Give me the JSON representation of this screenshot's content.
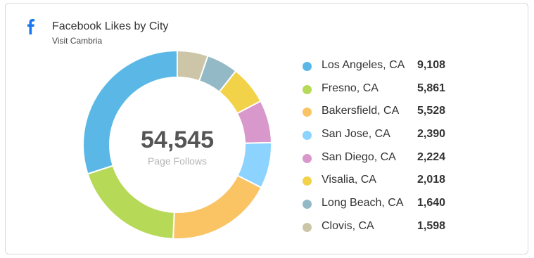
{
  "header": {
    "icon": "facebook-icon",
    "icon_color": "#1877f2",
    "title": "Facebook Likes by City",
    "subtitle": "Visit Cambria"
  },
  "center": {
    "total": "54,545",
    "label": "Page Follows"
  },
  "chart_data": {
    "type": "pie",
    "variant": "donut",
    "title": "Facebook Likes by City",
    "subtitle": "Visit Cambria",
    "legend_position": "right",
    "series": [
      {
        "name": "Los Angeles, CA",
        "value": 9108,
        "label": "9,108",
        "color": "#5bb8e6"
      },
      {
        "name": "Fresno, CA",
        "value": 5861,
        "label": "5,861",
        "color": "#b6d957"
      },
      {
        "name": "Bakersfield, CA",
        "value": 5528,
        "label": "5,528",
        "color": "#fac364"
      },
      {
        "name": "San Jose, CA",
        "value": 2390,
        "label": "2,390",
        "color": "#8cd3ff"
      },
      {
        "name": "San Diego, CA",
        "value": 2224,
        "label": "2,224",
        "color": "#d998cb"
      },
      {
        "name": "Visalia, CA",
        "value": 2018,
        "label": "2,018",
        "color": "#f2d249"
      },
      {
        "name": "Long Beach, CA",
        "value": 1640,
        "label": "1,640",
        "color": "#93b9c6"
      },
      {
        "name": "Clovis, CA",
        "value": 1598,
        "label": "1,598",
        "color": "#ccc5a8"
      }
    ]
  }
}
